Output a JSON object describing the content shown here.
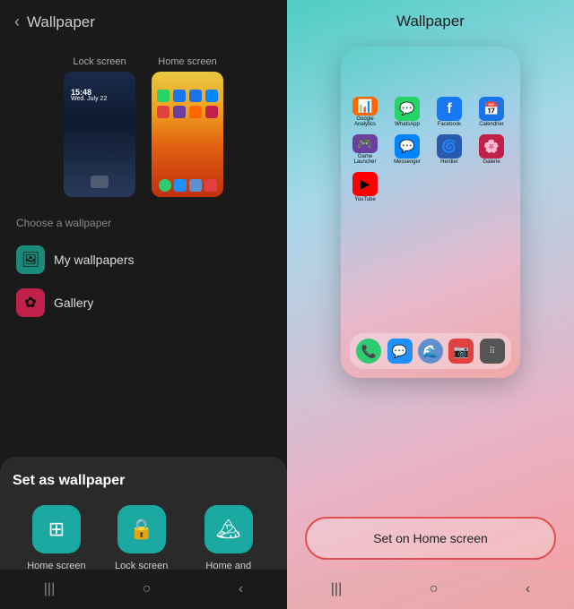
{
  "left": {
    "title": "Wallpaper",
    "back_label": "‹",
    "preview_lock_label": "Lock screen",
    "preview_home_label": "Home screen",
    "lock_time": "15:48",
    "lock_date": "Wed. July 22",
    "choose_label": "Choose a wallpaper",
    "option_my_wallpapers": "My wallpapers",
    "option_gallery": "Gallery",
    "my_wallpapers_icon": "🖼",
    "gallery_icon": "✿",
    "bottom_sheet_title": "Set as wallpaper",
    "set_options": [
      {
        "label": "Home screen",
        "icon": "⊞"
      },
      {
        "label": "Lock screen",
        "icon": "🔒"
      },
      {
        "label": "Home and lock screens",
        "icon": "🏔"
      }
    ]
  },
  "right": {
    "title": "Wallpaper",
    "apps": [
      {
        "label": "Google Analytics",
        "color": "#ff6600",
        "icon": "📊"
      },
      {
        "label": "WhatsApp",
        "color": "#25d366",
        "icon": "💬"
      },
      {
        "label": "Facebook",
        "color": "#1877f2",
        "icon": "f"
      },
      {
        "label": "Calendrier",
        "color": "#1a73e8",
        "icon": "📅"
      },
      {
        "label": "Game Launcher",
        "color": "#6b3fa0",
        "icon": "🎮"
      },
      {
        "label": "Messenger",
        "color": "#0084ff",
        "icon": "💬"
      },
      {
        "label": "Herdier",
        "color": "#2a5aad",
        "icon": "🌀"
      },
      {
        "label": "Galerie",
        "color": "#c0204a",
        "icon": "🌸"
      },
      {
        "label": "YouTube",
        "color": "#ff0000",
        "icon": "▶"
      }
    ],
    "dock": [
      {
        "label": "Phone",
        "color": "#2ecc71",
        "icon": "📞"
      },
      {
        "label": "Messages",
        "color": "#1e90ff",
        "icon": "💬"
      },
      {
        "label": "Samsung",
        "color": "#6090d0",
        "icon": "🌊"
      },
      {
        "label": "Camera",
        "color": "#e04040",
        "icon": "📷"
      },
      {
        "label": "Apps",
        "color": "#555",
        "icon": "⠿"
      }
    ],
    "set_home_label": "Set on Home screen",
    "nav": {
      "recent": "|||",
      "home": "○",
      "back": "‹"
    }
  }
}
